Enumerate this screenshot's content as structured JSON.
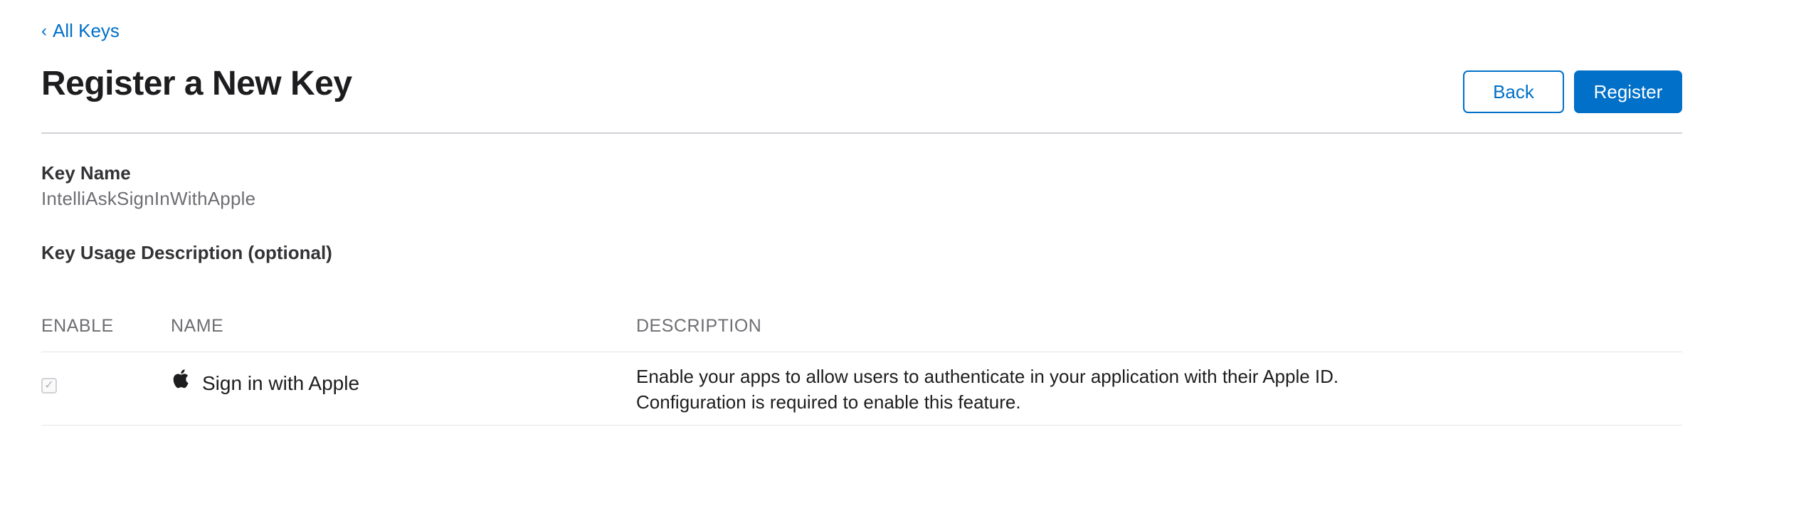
{
  "nav": {
    "back_chevron": "‹",
    "back_label": "All Keys"
  },
  "header": {
    "title": "Register a New Key",
    "back_button": "Back",
    "register_button": "Register"
  },
  "form": {
    "key_name_label": "Key Name",
    "key_name_value": "IntelliAskSignInWithApple",
    "usage_description_label": "Key Usage Description (optional)"
  },
  "table": {
    "columns": [
      "ENABLE",
      "NAME",
      "DESCRIPTION"
    ],
    "rows": [
      {
        "enabled": true,
        "icon": "apple-icon",
        "name": "Sign in with Apple",
        "description": "Enable your apps to allow users to authenticate in your application with their Apple ID. Configuration is required to enable this feature."
      }
    ]
  },
  "colors": {
    "accent": "#0070c9",
    "title": "#1d1d1f",
    "muted": "#6e6e73",
    "divider": "#d2d2d7"
  }
}
